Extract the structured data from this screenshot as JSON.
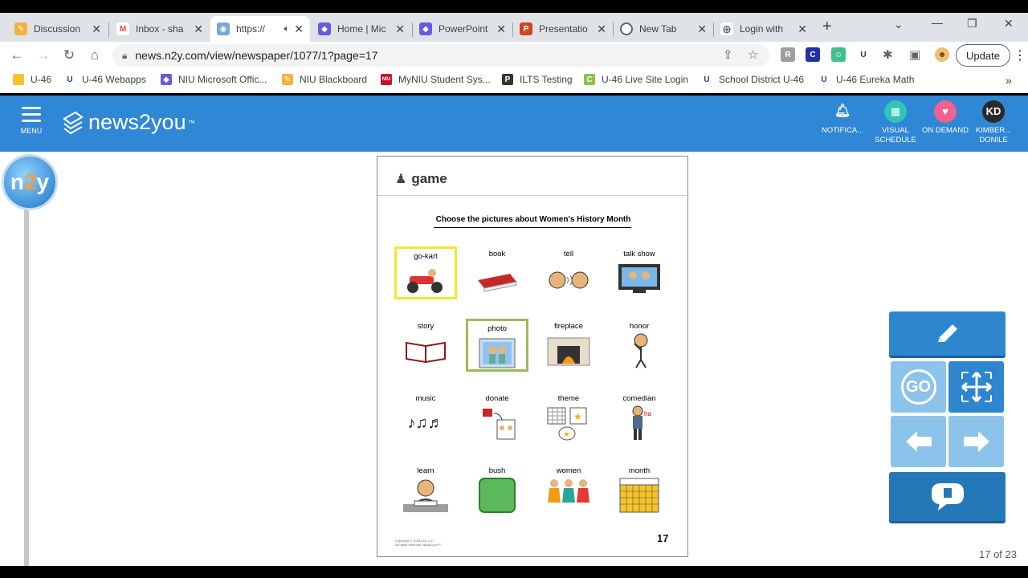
{
  "browser": {
    "tabs": [
      {
        "title": "Discussion",
        "favicon": "pencil-icon",
        "color": "#f2b33d"
      },
      {
        "title": "Inbox - sha",
        "favicon": "gmail-icon",
        "color": "#ea4335"
      },
      {
        "title": "https://",
        "favicon": "globe-icon",
        "color": "#7aa7d9",
        "audio": true,
        "active": true
      },
      {
        "title": "Home | Mic",
        "favicon": "copilot-icon",
        "color": "#6a5bdc"
      },
      {
        "title": "PowerPoint",
        "favicon": "copilot-icon",
        "color": "#6a5bdc"
      },
      {
        "title": "Presentatio",
        "favicon": "powerpoint-icon",
        "color": "#d04423"
      },
      {
        "title": "New Tab",
        "favicon": "chrome-icon",
        "color": "#5f6368"
      },
      {
        "title": "Login with",
        "favicon": "globe-icon",
        "color": "#5f6368"
      }
    ],
    "url": "news.n2y.com/view/newspaper/1077/1?page=17",
    "update_label": "Update",
    "bookmarks": [
      {
        "label": "U-46",
        "icon": "folder-icon",
        "color": "#f4c430"
      },
      {
        "label": "U-46 Webapps",
        "icon": "u46-icon",
        "color": "#1f3b8c"
      },
      {
        "label": "NIU Microsoft Offic...",
        "icon": "copilot-icon",
        "color": "#6a5bdc"
      },
      {
        "label": "NIU Blackboard",
        "icon": "pencil-icon",
        "color": "#f2b33d"
      },
      {
        "label": "MyNIU Student Sys...",
        "icon": "niu-icon",
        "color": "#c8102e"
      },
      {
        "label": "ILTS Testing",
        "icon": "p-icon",
        "color": "#333333"
      },
      {
        "label": "U-46 Live Site Login",
        "icon": "c-icon",
        "color": "#8bc34a"
      },
      {
        "label": "School District U-46",
        "icon": "u46-icon",
        "color": "#1f3b8c"
      },
      {
        "label": "U-46 Eureka Math",
        "icon": "u46-icon",
        "color": "#1f3b8c"
      }
    ]
  },
  "app": {
    "menu_label": "MENU",
    "logo_text": "news2you",
    "logo_tm": "™",
    "header_items": [
      {
        "label": "NOTIFICA...",
        "icon": "bell-icon"
      },
      {
        "label": "VISUAL SCHEDULE",
        "icon": "calendar-icon",
        "color": "#2ec4b6"
      },
      {
        "label": "ON DEMAND",
        "icon": "heart-icon",
        "color": "#f06292"
      },
      {
        "label": "KIMBER... DONILE",
        "initials": "KD",
        "color": "#2a2a2a"
      }
    ],
    "badge": {
      "n": "n",
      "two": "2",
      "y": "y"
    }
  },
  "document": {
    "heading": "game",
    "title": "Choose the pictures about Women's History Month",
    "items": [
      {
        "label": "go-kart",
        "icon": "go-kart-icon",
        "selected": "yellow"
      },
      {
        "label": "book",
        "icon": "book-icon"
      },
      {
        "label": "tell",
        "icon": "tell-icon"
      },
      {
        "label": "talk show",
        "icon": "tv-icon"
      },
      {
        "label": "story",
        "icon": "open-book-icon"
      },
      {
        "label": "photo",
        "icon": "photo-icon",
        "selected": "green"
      },
      {
        "label": "fireplace",
        "icon": "fireplace-icon"
      },
      {
        "label": "honor",
        "icon": "person-icon"
      },
      {
        "label": "music",
        "icon": "music-notes-icon"
      },
      {
        "label": "donate",
        "icon": "donate-icon"
      },
      {
        "label": "theme",
        "icon": "theme-icon"
      },
      {
        "label": "comedian",
        "icon": "comedian-icon"
      },
      {
        "label": "learn",
        "icon": "learn-icon"
      },
      {
        "label": "bush",
        "icon": "bush-icon"
      },
      {
        "label": "women",
        "icon": "women-icon"
      },
      {
        "label": "month",
        "icon": "calendar-icon"
      }
    ],
    "copyright_1": "Copyright © 2023 n2y, LLC",
    "copyright_2": "All rights reserved. News2you™",
    "page_number": "17"
  },
  "tools": {
    "go_label": "GO",
    "pager": "17 of 23"
  }
}
